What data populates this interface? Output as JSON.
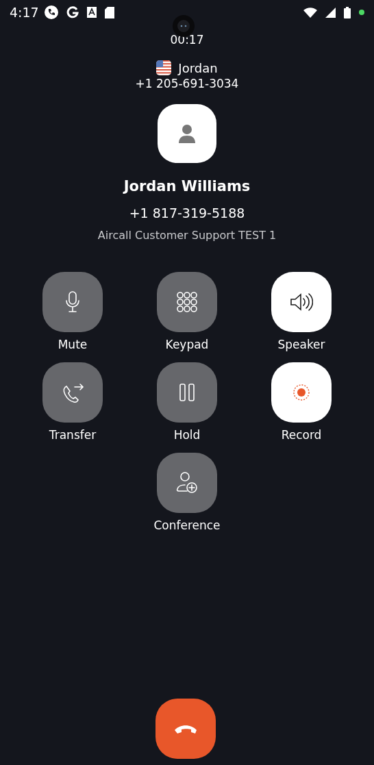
{
  "status_bar": {
    "time": "4:17"
  },
  "call": {
    "duration": "00:17",
    "line_name": "Jordan",
    "line_number": "+1 205-691-3034"
  },
  "contact": {
    "name": "Jordan Williams",
    "number": "+1 817-319-5188",
    "company": "Aircall Customer Support TEST 1"
  },
  "actions": [
    {
      "kind": "mute",
      "label": "Mute",
      "on": false
    },
    {
      "kind": "keypad",
      "label": "Keypad",
      "on": false
    },
    {
      "kind": "speaker",
      "label": "Speaker",
      "on": true
    },
    {
      "kind": "transfer",
      "label": "Transfer",
      "on": false
    },
    {
      "kind": "hold",
      "label": "Hold",
      "on": false
    },
    {
      "kind": "record",
      "label": "Record",
      "on": true
    },
    {
      "kind": "conference",
      "label": "Conference",
      "on": false
    }
  ]
}
